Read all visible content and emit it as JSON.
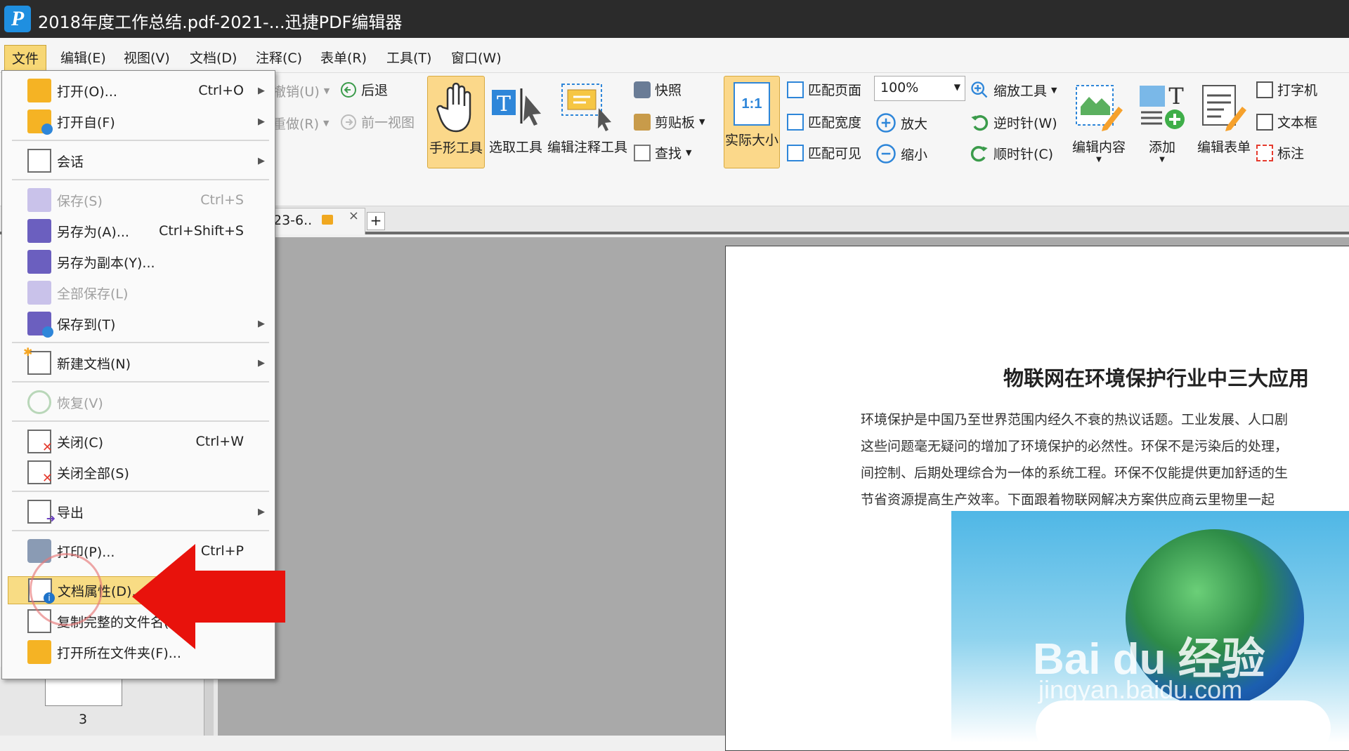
{
  "window": {
    "title": "2018年度工作总结.pdf-2021-...迅捷PDF编辑器",
    "logo_letter": "P"
  },
  "menubar": {
    "items": [
      "文件",
      "编辑(E)",
      "视图(V)",
      "文档(D)",
      "注释(C)",
      "表单(R)",
      "工具(T)",
      "窗口(W)"
    ]
  },
  "ribbon": {
    "undo": "撤销(U)",
    "redo": "重做(R)",
    "back": "后退",
    "prev_view": "前一视图",
    "hand_tool": "手形工具",
    "select_tool": "选取工具",
    "edit_annot_tool": "编辑注释工具",
    "snapshot": "快照",
    "clipboard": "剪贴板",
    "find": "查找",
    "actual_size": "实际大小",
    "actual_size_icon_text": "1:1",
    "fit_page": "匹配页面",
    "fit_width": "匹配宽度",
    "fit_visible": "匹配可见",
    "zoom_value": "100%",
    "zoom_tool": "缩放工具",
    "zoom_in": "放大",
    "zoom_out": "缩小",
    "ccw": "逆时针(W)",
    "cw": "顺时针(C)",
    "edit_content": "编辑内容",
    "add": "添加",
    "edit_form": "编辑表单",
    "typewriter": "打字机",
    "textbox": "文本框",
    "callout": "标注"
  },
  "tab": {
    "label": "23-6..",
    "close": "×",
    "new": "+"
  },
  "file_menu": {
    "items": [
      {
        "label": "打开(O)...",
        "shortcut": "Ctrl+O",
        "submenu": true
      },
      {
        "label": "打开自(F)",
        "shortcut": "",
        "submenu": true
      },
      {
        "label": "会话",
        "shortcut": "",
        "submenu": true
      },
      {
        "label": "保存(S)",
        "shortcut": "Ctrl+S",
        "submenu": false
      },
      {
        "label": "另存为(A)...",
        "shortcut": "Ctrl+Shift+S",
        "submenu": false
      },
      {
        "label": "另存为副本(Y)...",
        "shortcut": "",
        "submenu": false
      },
      {
        "label": "全部保存(L)",
        "shortcut": "",
        "submenu": false
      },
      {
        "label": "保存到(T)",
        "shortcut": "",
        "submenu": true
      },
      {
        "label": "新建文档(N)",
        "shortcut": "",
        "submenu": true
      },
      {
        "label": "恢复(V)",
        "shortcut": "",
        "submenu": false
      },
      {
        "label": "关闭(C)",
        "shortcut": "Ctrl+W",
        "submenu": false
      },
      {
        "label": "关闭全部(S)",
        "shortcut": "",
        "submenu": false
      },
      {
        "label": "导出",
        "shortcut": "",
        "submenu": true
      },
      {
        "label": "打印(P)...",
        "shortcut": "Ctrl+P",
        "submenu": false
      },
      {
        "label": "文档属性(D)...",
        "shortcut": "",
        "submenu": false
      },
      {
        "label": "复制完整的文件名(",
        "shortcut": "",
        "submenu": false
      },
      {
        "label": "打开所在文件夹(F)...",
        "shortcut": "",
        "submenu": false
      }
    ]
  },
  "document": {
    "heading": "物联网在环境保护行业中三大应用",
    "lines": [
      "环境保护是中国乃至世界范围内经久不衰的热议话题。工业发展、人口剧",
      "这些问题毫无疑问的增加了环境保护的必然性。环保不是污染后的处理，",
      "间控制、后期处理综合为一体的系统工程。环保不仅能提供更加舒适的生",
      "节省资源提高生产效率。下面跟着物联网解决方案供应商云里物里一起"
    ],
    "watermark": "Bai du 经验",
    "watermark_sub": "jingyan.baidu.com"
  },
  "thumbnails": {
    "page_number": "3"
  },
  "colors": {
    "highlight": "#f8dc84",
    "arrow": "#e8120c",
    "titlebar": "#2b2b2b"
  }
}
